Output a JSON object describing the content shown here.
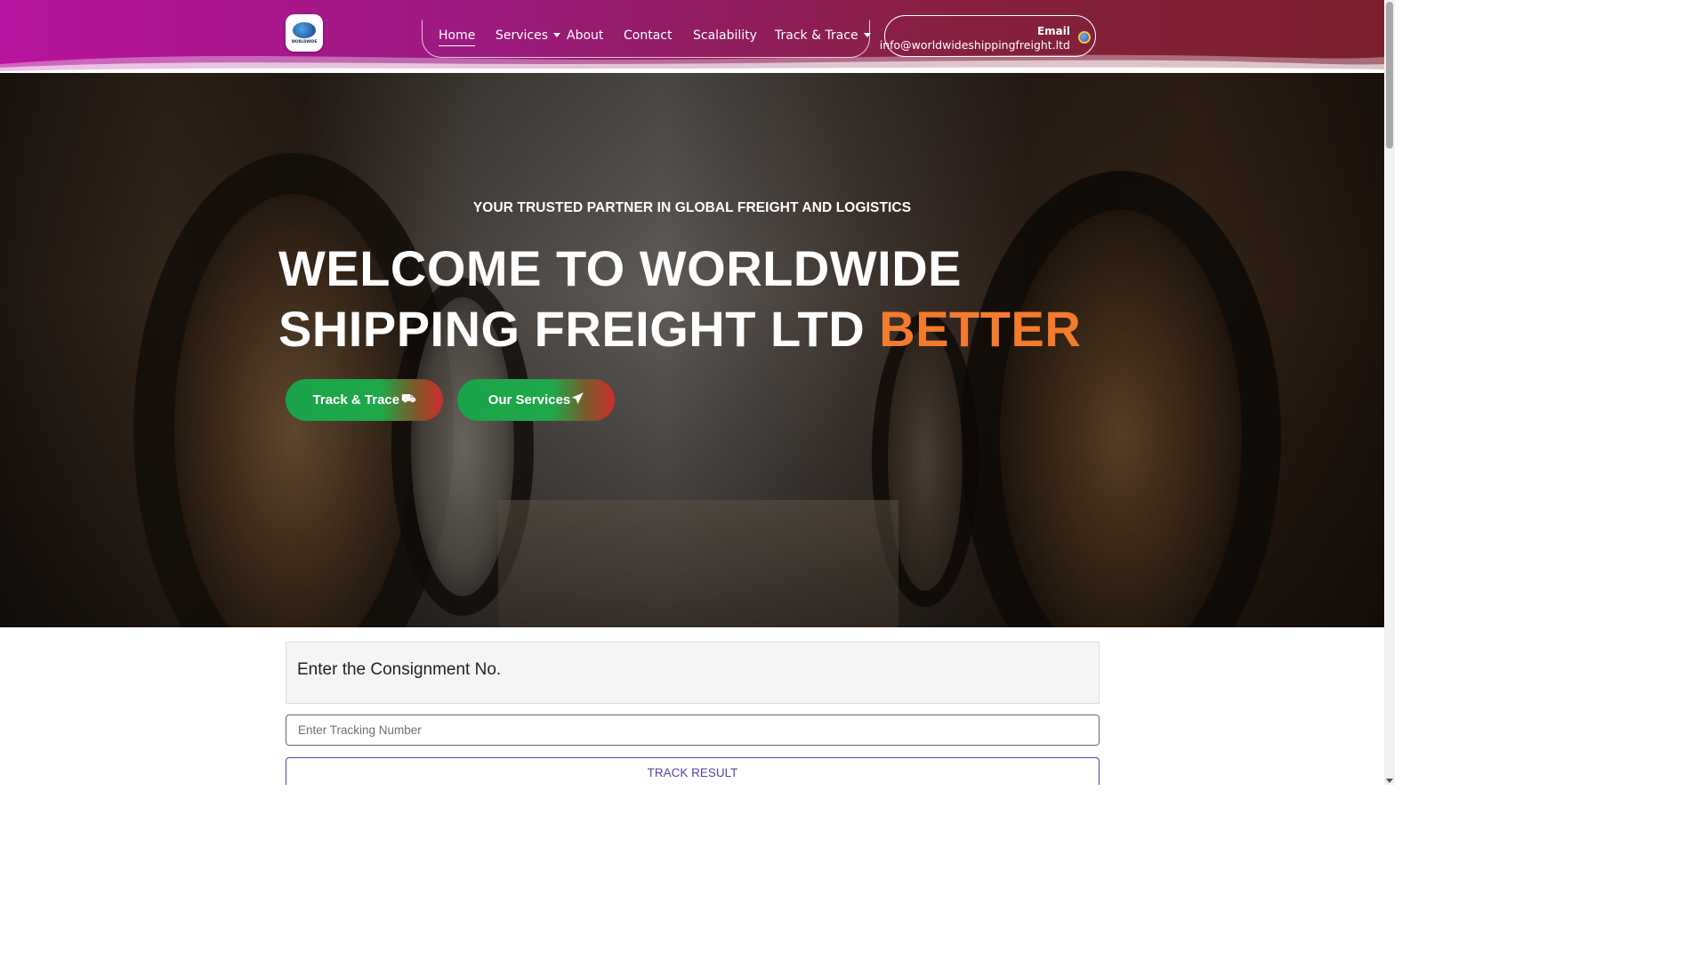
{
  "header": {
    "logo_text": "WORLDWIDE",
    "nav": [
      {
        "label": "Home",
        "active": true,
        "dropdown": false
      },
      {
        "label": "Services",
        "active": false,
        "dropdown": true
      },
      {
        "label": "About",
        "active": false,
        "dropdown": false
      },
      {
        "label": "Contact",
        "active": false,
        "dropdown": false
      },
      {
        "label": "Scalability",
        "active": false,
        "dropdown": false
      },
      {
        "label": "Track & Trace",
        "active": false,
        "dropdown": true
      }
    ],
    "email_label": "Email",
    "email_value": "info@worldwideshippingfreight.ltd",
    "colors": {
      "header_start": "#b7139e",
      "header_end": "#7a1f2c"
    }
  },
  "hero": {
    "tagline": "YOUR TRUSTED PARTNER IN GLOBAL FREIGHT AND LOGISTICS",
    "headline_line1": "WELCOME TO WORLDWIDE",
    "headline_line2": "SHIPPING FREIGHT LTD",
    "headline_accent": "BETTER",
    "accent_color": "#f47a2e",
    "buttons": [
      {
        "label": "Track & Trace",
        "icon": "truck-fast-icon"
      },
      {
        "label": "Our Services",
        "icon": "paper-plane-icon"
      }
    ]
  },
  "tracking": {
    "title": "Enter the Consignment No.",
    "input_placeholder": "Enter Tracking Number",
    "submit_label": "TRACK RESULT"
  }
}
